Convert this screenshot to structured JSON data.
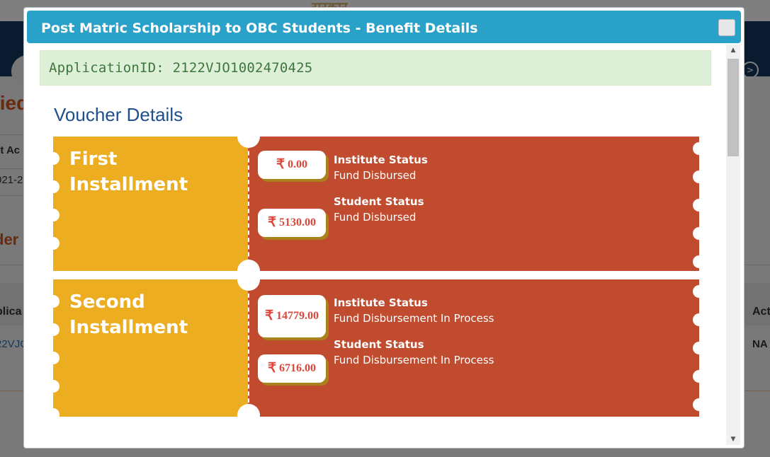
{
  "background": {
    "top_text": "सरकार",
    "title_fragment_1": "lied",
    "title_fragment_2": "der",
    "col_fragment_1": "ct Ac",
    "col_fragment_2": "021-2",
    "col_fragment_3": "plica",
    "col_fragment_4": "22VJC",
    "col_fragment_5": "Act",
    "col_fragment_6": "NA"
  },
  "modal": {
    "title": "Post Matric Scholarship to OBC Students - Benefit Details",
    "application_id": "ApplicationID: 2122VJO1002470425",
    "section_title": "Voucher Details",
    "currency_symbol": "₹",
    "vouchers": [
      {
        "title": "First Installment",
        "institute_amount": "0.00",
        "institute_label": "Institute Status",
        "institute_status": "Fund Disbursed",
        "student_amount": "5130.00",
        "student_label": "Student Status",
        "student_status": "Fund Disbursed"
      },
      {
        "title": "Second Installment",
        "institute_amount": "14779.00",
        "institute_label": "Institute Status",
        "institute_status": "Fund Disbursement In Process",
        "student_amount": "6716.00",
        "student_label": "Student Status",
        "student_status": "Fund Disbursement In Process"
      }
    ]
  },
  "colors": {
    "header": "#2aa1c9",
    "voucher_left": "#edad20",
    "voucher_right": "#c04b2e",
    "amount_text": "#e0463a",
    "appid_bg": "#dff0d8",
    "section_title": "#1f4e8c"
  },
  "icons": {
    "close": "close-icon",
    "scroll_up": "scroll-up-arrow-icon",
    "scroll_down": "scroll-down-arrow-icon",
    "rupee": "rupee-icon"
  }
}
